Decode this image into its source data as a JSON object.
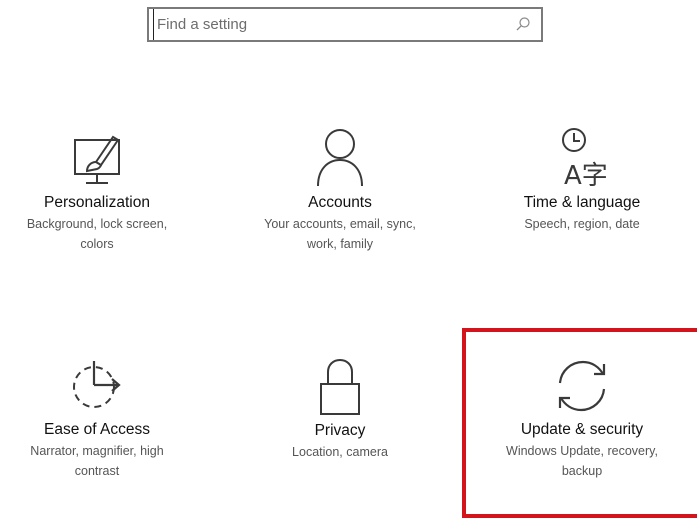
{
  "search": {
    "placeholder": "Find a setting",
    "icon": "search-icon"
  },
  "tiles": [
    {
      "title": "Personalization",
      "description_line1": "Background, lock screen,",
      "description_line2": "colors",
      "icon": "personalization-icon"
    },
    {
      "title": "Accounts",
      "description_line1": "Your accounts, email, sync,",
      "description_line2": "work, family",
      "icon": "accounts-icon"
    },
    {
      "title": "Time & language",
      "description_line1": "Speech, region, date",
      "description_line2": "",
      "icon": "time-language-icon"
    },
    {
      "title": "Ease of Access",
      "description_line1": "Narrator, magnifier, high",
      "description_line2": "contrast",
      "icon": "ease-of-access-icon"
    },
    {
      "title": "Privacy",
      "description_line1": "Location, camera",
      "description_line2": "",
      "icon": "privacy-icon"
    },
    {
      "title": "Update & security",
      "description_line1": "Windows Update, recovery,",
      "description_line2": "backup",
      "icon": "update-security-icon"
    }
  ],
  "time_language_icon_glyph": "A字",
  "colors": {
    "highlight_border": "#d3141c",
    "icon_stroke": "#3a3a3a",
    "text_primary": "#111111",
    "text_secondary": "#555555"
  }
}
